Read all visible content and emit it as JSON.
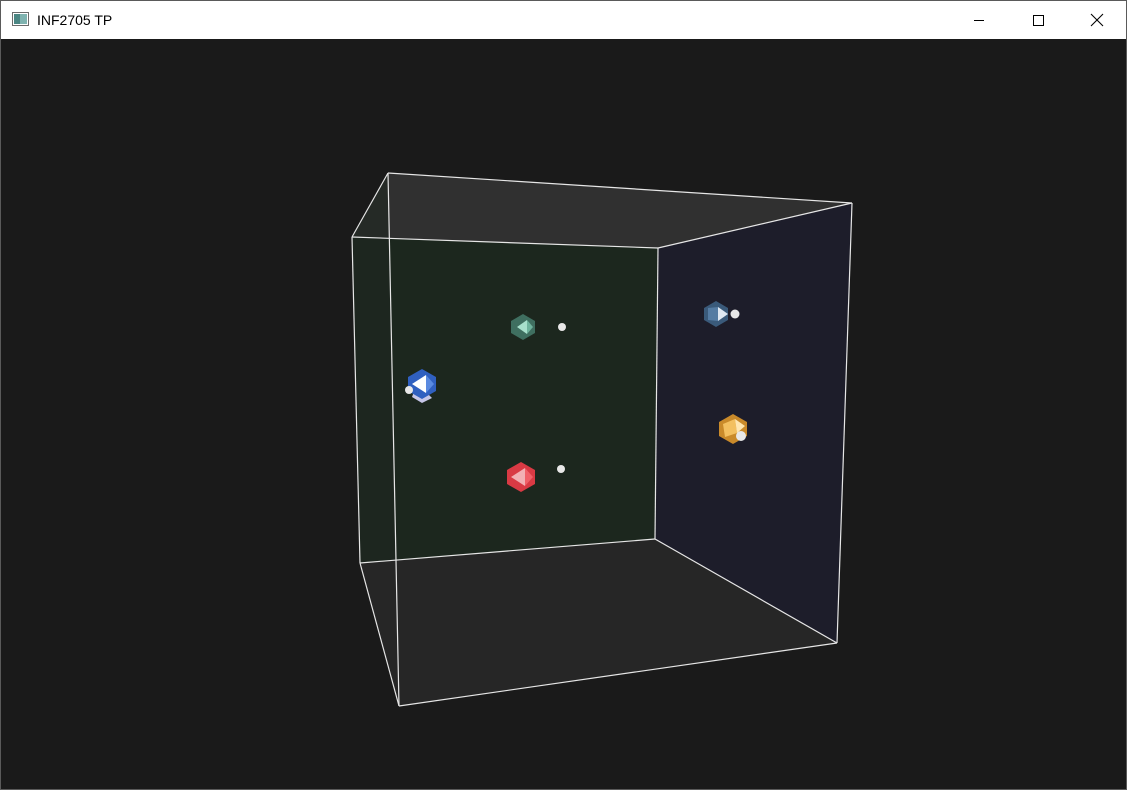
{
  "window": {
    "title": "INF2705 TP",
    "icon": "app-window-icon",
    "controls": {
      "minimize_icon": "minimize-icon",
      "maximize_icon": "maximize-icon",
      "close_icon": "close-icon"
    }
  },
  "scene": {
    "background_color": "#1a1a1a",
    "edge_color": "#e6e6e6",
    "objects": [
      {
        "name": "teal-icosahedron",
        "color": "#5fa48f",
        "light": "white"
      },
      {
        "name": "blue-icosahedron-top-right",
        "color": "#4a6f93",
        "light": "white"
      },
      {
        "name": "blue-icosahedron-left",
        "color": "#3f6fcf",
        "light": "white"
      },
      {
        "name": "orange-icosahedron",
        "color": "#e0a040",
        "light": "white"
      },
      {
        "name": "red-icosahedron",
        "color": "#e0404a",
        "light": "white"
      }
    ]
  }
}
